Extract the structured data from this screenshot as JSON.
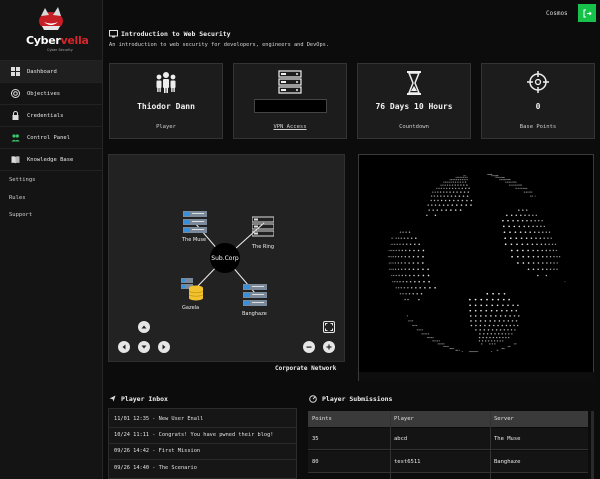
{
  "brand": {
    "name_a": "Cyber",
    "name_b": "vella",
    "tagline": "Cyber Security"
  },
  "sidebar": {
    "items": [
      {
        "label": "Dashboard",
        "icon": "dashboard-icon"
      },
      {
        "label": "Objectives",
        "icon": "target-icon"
      },
      {
        "label": "Credentials",
        "icon": "lock-icon"
      },
      {
        "label": "Control Panel",
        "icon": "users-icon"
      },
      {
        "label": "Knowledge Base",
        "icon": "book-icon"
      }
    ],
    "links": [
      "Settings",
      "Rules",
      "Support"
    ]
  },
  "topbar": {
    "user": "Cosmos",
    "logout_icon": "logout-icon",
    "logout_color": "#16c24a"
  },
  "header": {
    "title": "Introduction to Web Security",
    "subtitle": "An introduction to web security for developers, engineers and DevOps."
  },
  "cards": [
    {
      "icon": "team-icon",
      "value": "Thiodor Dann",
      "caption": "Player"
    },
    {
      "icon": "server-icon",
      "value": "",
      "caption": "VPN Access"
    },
    {
      "icon": "hourglass-icon",
      "value": "76 Days 10 Hours",
      "caption": "Countdown"
    },
    {
      "icon": "crosshair-icon",
      "value": "0",
      "caption": "Base Points"
    }
  ],
  "network": {
    "center": "Sub.Corp",
    "nodes": [
      "The Muse",
      "The Ring",
      "Gazela",
      "Banghaze"
    ],
    "caption": "Corporate Network"
  },
  "inbox": {
    "title": "Player Inbox",
    "messages": [
      "11/01 12:35 - New User Enall",
      "10/24 11:11 - Congrats! You have pwned their blog!",
      "09/26 14:42 - First Mission",
      "09/26 14:40 - The Scenario"
    ]
  },
  "submissions": {
    "title": "Player Submissions",
    "columns": [
      "Points",
      "Player",
      "Server"
    ],
    "rows": [
      [
        "35",
        "abcd",
        "The Muse"
      ],
      [
        "80",
        "test6511",
        "Banghaze"
      ]
    ]
  },
  "colors": {
    "accent": "#d6262c",
    "success": "#16c24a",
    "bg": "#0c0c0c"
  }
}
